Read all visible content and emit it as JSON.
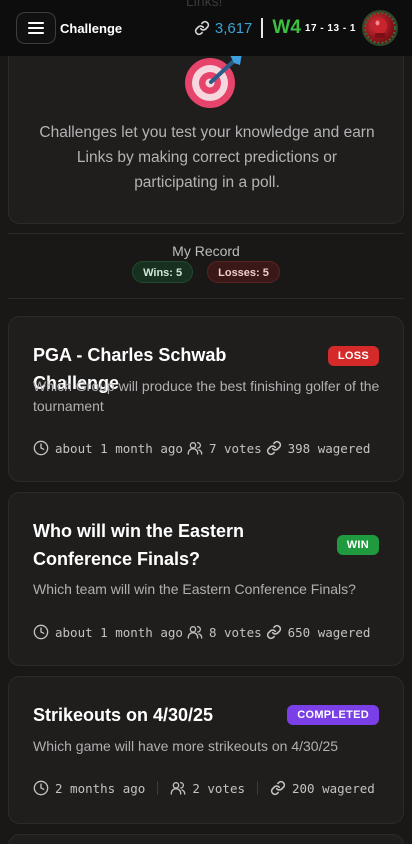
{
  "header": {
    "ghost_text": "Links!",
    "title": "Challenge",
    "links_count": "3,617",
    "streak": "W4",
    "record": "17 - 13 - 1"
  },
  "intro": {
    "text": "Challenges let you test your knowledge and earn Links by making correct predictions or participating in a poll."
  },
  "record": {
    "title": "My Record",
    "wins_label": "Wins: 5",
    "losses_label": "Losses: 5"
  },
  "challenges": [
    {
      "title": "PGA - Charles Schwab Challenge",
      "status": "LOSS",
      "description": "Which Group will produce the best finishing golfer of the tournament",
      "time": "about 1 month ago",
      "votes": "7 votes",
      "wagered": "398 wagered"
    },
    {
      "title": "Who will win the Eastern Conference Finals?",
      "status": "WIN",
      "description": "Which team will win the Eastern Conference Finals?",
      "time": "about 1 month ago",
      "votes": "8 votes",
      "wagered": "650 wagered"
    },
    {
      "title": "Strikeouts on 4/30/25",
      "status": "COMPLETED",
      "description": "Which game will have more strikeouts on 4/30/25",
      "time": "2 months ago",
      "votes": "2 votes",
      "wagered": "200 wagered"
    }
  ],
  "colors": {
    "link_blue": "#3aa3d6",
    "streak_green": "#3fbf3f",
    "loss_red": "#d42a2a",
    "win_green": "#1f9a3f",
    "completed_purple": "#7a3fe6"
  },
  "icons": {
    "menu": "hamburger-menu-icon",
    "link": "link-chain-icon",
    "intro": "target-dart-icon",
    "time": "clock-icon",
    "votes": "users-icon",
    "wagered": "link-chain-icon"
  }
}
